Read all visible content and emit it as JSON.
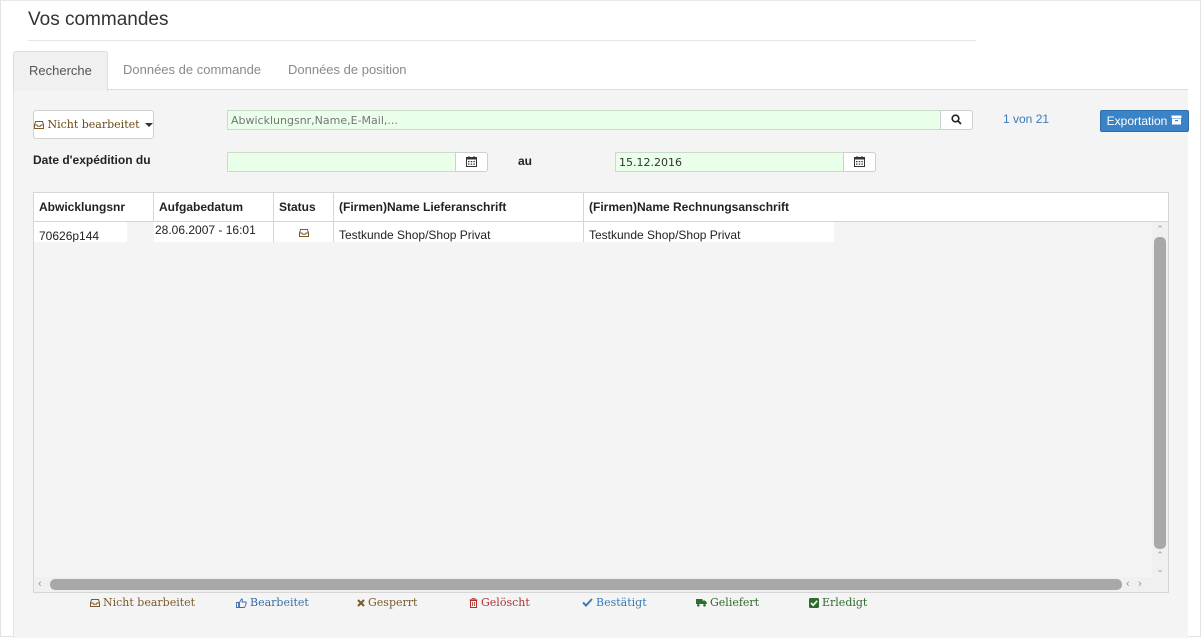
{
  "page": {
    "title": "Vos commandes"
  },
  "tabs": [
    {
      "label": "Recherche",
      "active": true
    },
    {
      "label": "Données de commande",
      "active": false
    },
    {
      "label": "Données de position",
      "active": false
    }
  ],
  "filters": {
    "status_dropdown": {
      "label": "Nicht bearbeitet",
      "icon": "inbox-icon"
    },
    "search": {
      "placeholder": "Abwicklungsnr,Name,E-Mail,...",
      "value": ""
    },
    "pager": "1 von 21",
    "export_label": "Exportation",
    "date_label": "Date d'expédition du",
    "date_from": "",
    "au_label": "au",
    "date_to": "15.12.2016"
  },
  "grid": {
    "columns": [
      "Abwicklungsnr",
      "Aufgabedatum",
      "Status",
      "(Firmen)Name Lieferanschrift",
      "(Firmen)Name Rechnungsanschrift"
    ],
    "rows": [
      {
        "abwicklungsnr": "70626p144",
        "aufgabedatum": "28.06.2007 - 16:01",
        "status_icon": "inbox-icon",
        "lieferanschrift": "Testkunde Shop/Shop Privat",
        "rechnungsanschrift": "Testkunde Shop/Shop Privat"
      }
    ]
  },
  "legend": [
    {
      "label": "Nicht bearbeitet",
      "icon": "inbox-icon",
      "color": "#7a5a2a"
    },
    {
      "label": "Bearbeitet",
      "icon": "thumbs-up-icon",
      "color": "#3a6ea5"
    },
    {
      "label": "Gesperrt",
      "icon": "times-icon",
      "color": "#7a5a2a"
    },
    {
      "label": "Gelöscht",
      "icon": "trash-icon",
      "color": "#b03030"
    },
    {
      "label": "Bestätigt",
      "icon": "check-icon",
      "color": "#3a7ab8"
    },
    {
      "label": "Geliefert",
      "icon": "truck-icon",
      "color": "#2e6b2e"
    },
    {
      "label": "Erledigt",
      "icon": "check-square-icon",
      "color": "#2e6b2e"
    }
  ]
}
